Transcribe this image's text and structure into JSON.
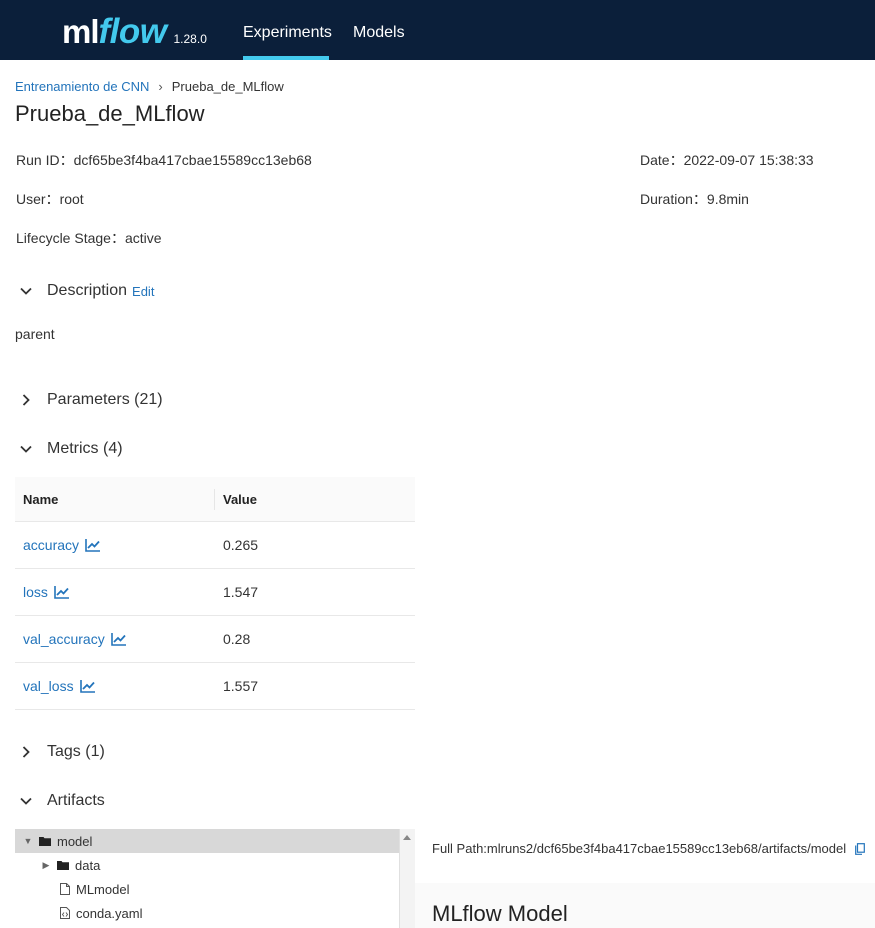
{
  "header": {
    "logo_ml": "ml",
    "logo_flow": "flow",
    "version": "1.28.0",
    "nav": [
      {
        "label": "Experiments",
        "active": true
      },
      {
        "label": "Models",
        "active": false
      }
    ],
    "bg_color": "#0b1f3a",
    "accent_color": "#43c9ed"
  },
  "breadcrumb": {
    "parent": "Entrenamiento de CNN",
    "separator": "›",
    "current": "Prueba_de_MLflow"
  },
  "title": "Prueba_de_MLflow",
  "meta": {
    "run_id_label": "Run ID：",
    "run_id": "dcf65be3f4ba417cbae15589cc13eb68",
    "user_label": "User：",
    "user": "root",
    "lifecycle_label": "Lifecycle Stage：",
    "lifecycle": "active",
    "date_label": "Date：",
    "date": "2022-09-07 15:38:33",
    "duration_label": "Duration：",
    "duration": "9.8min"
  },
  "sections": {
    "description": {
      "label": "Description",
      "edit": "Edit",
      "expanded": true,
      "text": "parent"
    },
    "parameters": {
      "label": "Parameters (21)",
      "expanded": false
    },
    "metrics": {
      "label": "Metrics (4)",
      "expanded": true
    },
    "tags": {
      "label": "Tags (1)",
      "expanded": false
    },
    "artifacts": {
      "label": "Artifacts",
      "expanded": true
    }
  },
  "metrics_table": {
    "col_name": "Name",
    "col_value": "Value",
    "rows": [
      {
        "name": "accuracy",
        "value": "0.265",
        "icon": "line-chart-icon"
      },
      {
        "name": "loss",
        "value": "1.547",
        "icon": "line-chart-icon"
      },
      {
        "name": "val_accuracy",
        "value": "0.28",
        "icon": "line-chart-icon"
      },
      {
        "name": "val_loss",
        "value": "1.557",
        "icon": "line-chart-icon"
      }
    ]
  },
  "artifacts": {
    "tree": [
      {
        "name": "model",
        "type": "folder",
        "expanded": true,
        "selected": true
      },
      {
        "name": "data",
        "type": "folder",
        "expanded": false,
        "selected": false
      },
      {
        "name": "MLmodel",
        "type": "file",
        "selected": false
      },
      {
        "name": "conda.yaml",
        "type": "file",
        "selected": false
      }
    ],
    "full_path_label": "Full Path:",
    "full_path": "mlruns2/dcf65be3f4ba417cbae15589cc13eb68/artifacts/model",
    "model_title": "MLflow Model"
  }
}
